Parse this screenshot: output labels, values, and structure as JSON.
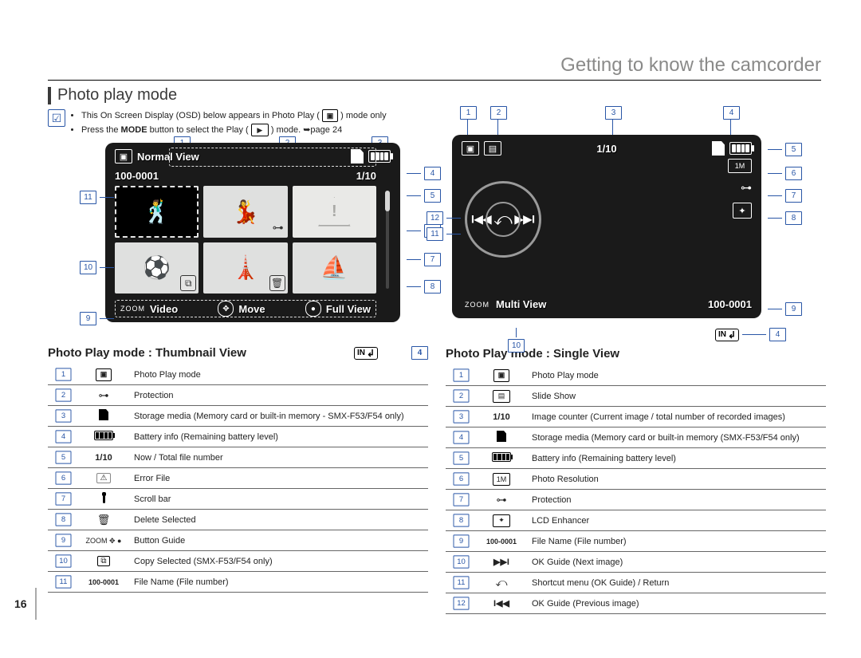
{
  "chapter_title": "Getting to know the camcorder",
  "section_title": "Photo play mode",
  "page_number": "16",
  "notes": {
    "line1_a": "This On Screen Display (OSD) below appears in Photo Play (",
    "line1_b": ") mode only",
    "line2_a": "Press the ",
    "line2_bold": "MODE",
    "line2_b": " button to select the Play (",
    "line2_c": ") mode. ➥page 24"
  },
  "osd_thumb": {
    "title": "Normal View",
    "file_name": "100-0001",
    "counter": "1/10",
    "bottom_left_small": "ZOOM",
    "bottom_left": "Video",
    "bottom_mid": "Move",
    "bottom_right": "Full View"
  },
  "osd_single": {
    "counter": "1/10",
    "bottom_left_small": "ZOOM",
    "bottom_left": "Multi View",
    "file_name": "100-0001"
  },
  "sub_thumb": "Photo Play mode : Thumbnail View",
  "sub_single": "Photo Play mode : Single View",
  "in_label": "IN",
  "legend_thumb": [
    {
      "n": "1",
      "icon": "photo",
      "text": "Photo Play mode"
    },
    {
      "n": "2",
      "icon": "key",
      "text": "Protection"
    },
    {
      "n": "3",
      "icon": "sd",
      "text": "Storage media (Memory card or built-in memory - SMX-F53/F54 only)"
    },
    {
      "n": "4",
      "icon": "batt",
      "text": "Battery info (Remaining battery level)"
    },
    {
      "n": "5",
      "icon": "ratio",
      "text": "Now / Total file number"
    },
    {
      "n": "6",
      "icon": "warn",
      "text": "Error File"
    },
    {
      "n": "7",
      "icon": "scroll",
      "text": "Scroll bar"
    },
    {
      "n": "8",
      "icon": "trash",
      "text": "Delete Selected"
    },
    {
      "n": "9",
      "icon": "guide",
      "text": "Button Guide"
    },
    {
      "n": "10",
      "icon": "copy",
      "text": "Copy Selected (SMX-F53/F54 only)"
    },
    {
      "n": "11",
      "icon": "filen",
      "text": "File Name (File number)"
    }
  ],
  "legend_single": [
    {
      "n": "1",
      "icon": "photo",
      "text": "Photo Play mode"
    },
    {
      "n": "2",
      "icon": "slide",
      "text": "Slide Show"
    },
    {
      "n": "3",
      "icon": "ratio",
      "text": "Image counter (Current image / total number of recorded images)"
    },
    {
      "n": "4",
      "icon": "sd",
      "text": "Storage media (Memory card or built-in memory (SMX-F53/F54 only)"
    },
    {
      "n": "5",
      "icon": "batt",
      "text": "Battery info (Remaining battery level)"
    },
    {
      "n": "6",
      "icon": "res",
      "text": "Photo Resolution"
    },
    {
      "n": "7",
      "icon": "key",
      "text": "Protection"
    },
    {
      "n": "8",
      "icon": "lcd",
      "text": "LCD Enhancer"
    },
    {
      "n": "9",
      "icon": "filen",
      "text": "File Name (File number)"
    },
    {
      "n": "10",
      "icon": "next",
      "text": "OK Guide (Next image)"
    },
    {
      "n": "11",
      "icon": "return",
      "text": "Shortcut menu (OK Guide) / Return"
    },
    {
      "n": "12",
      "icon": "prev",
      "text": "OK Guide (Previous image)"
    }
  ],
  "icons": {
    "ratio_text": "1/10",
    "filen_text": "100-0001",
    "res_text": "1M",
    "guide_text": "ZOOM ✥ ●"
  }
}
